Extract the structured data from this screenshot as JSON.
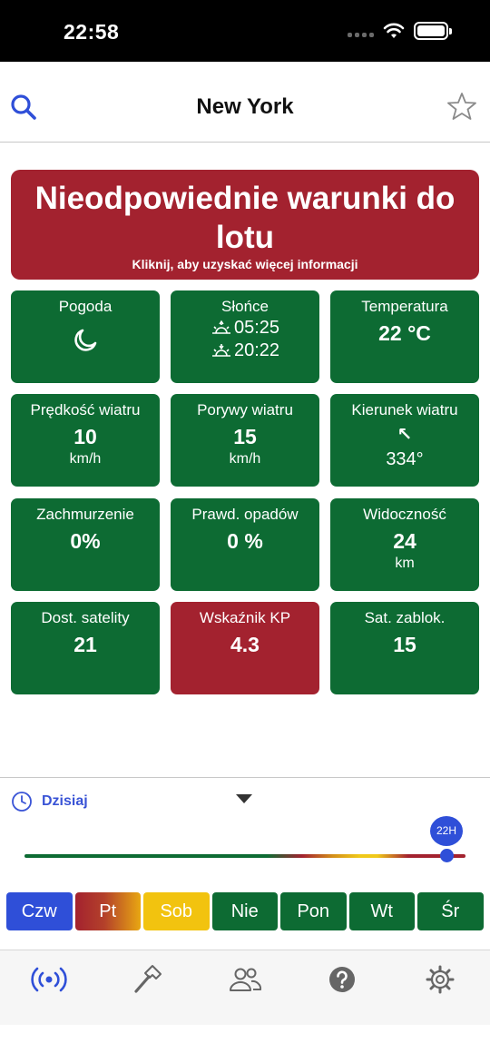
{
  "status": {
    "time": "22:58"
  },
  "header": {
    "title": "New York"
  },
  "banner": {
    "title": "Nieodpowiednie warunki do lotu",
    "subtitle": "Kliknij, aby uzyskać więcej informacji",
    "status_color": "#a3222f"
  },
  "tiles": {
    "weather": {
      "label": "Pogoda",
      "icon": "moon-icon"
    },
    "sun": {
      "label": "Słońce",
      "sunrise": "05:25",
      "sunset": "20:22"
    },
    "temperature": {
      "label": "Temperatura",
      "value": "22 °C"
    },
    "wind_speed": {
      "label": "Prędkość wiatru",
      "value": "10",
      "unit": "km/h"
    },
    "wind_gusts": {
      "label": "Porywy wiatru",
      "value": "15",
      "unit": "km/h"
    },
    "wind_direction": {
      "label": "Kierunek wiatru",
      "value": "334°",
      "arrow": "↖"
    },
    "clouds": {
      "label": "Zachmurzenie",
      "value": "0%"
    },
    "precip": {
      "label": "Prawd. opadów",
      "value": "0 %"
    },
    "visibility": {
      "label": "Widoczność",
      "value": "24",
      "unit": "km"
    },
    "satellites": {
      "label": "Dost. satelity",
      "value": "21"
    },
    "kp": {
      "label": "Wskaźnik KP",
      "value": "4.3",
      "status": "bad"
    },
    "locked_sats": {
      "label": "Sat. zablok.",
      "value": "15"
    }
  },
  "timeline": {
    "day_label": "Dzisiaj",
    "hour_bubble": "22H",
    "slider_fraction": 0.958
  },
  "days": [
    "Czw",
    "Pt",
    "Sob",
    "Nie",
    "Pon",
    "Wt",
    "Śr"
  ],
  "tabbar": {
    "items": [
      "broadcast-icon",
      "hammer-icon",
      "people-icon",
      "help-icon",
      "settings-gear-icon"
    ],
    "active": 0
  },
  "colors": {
    "good": "#0d6b33",
    "bad": "#a3222f",
    "warn": "#f2c30f",
    "accent": "#2f4fd8"
  }
}
